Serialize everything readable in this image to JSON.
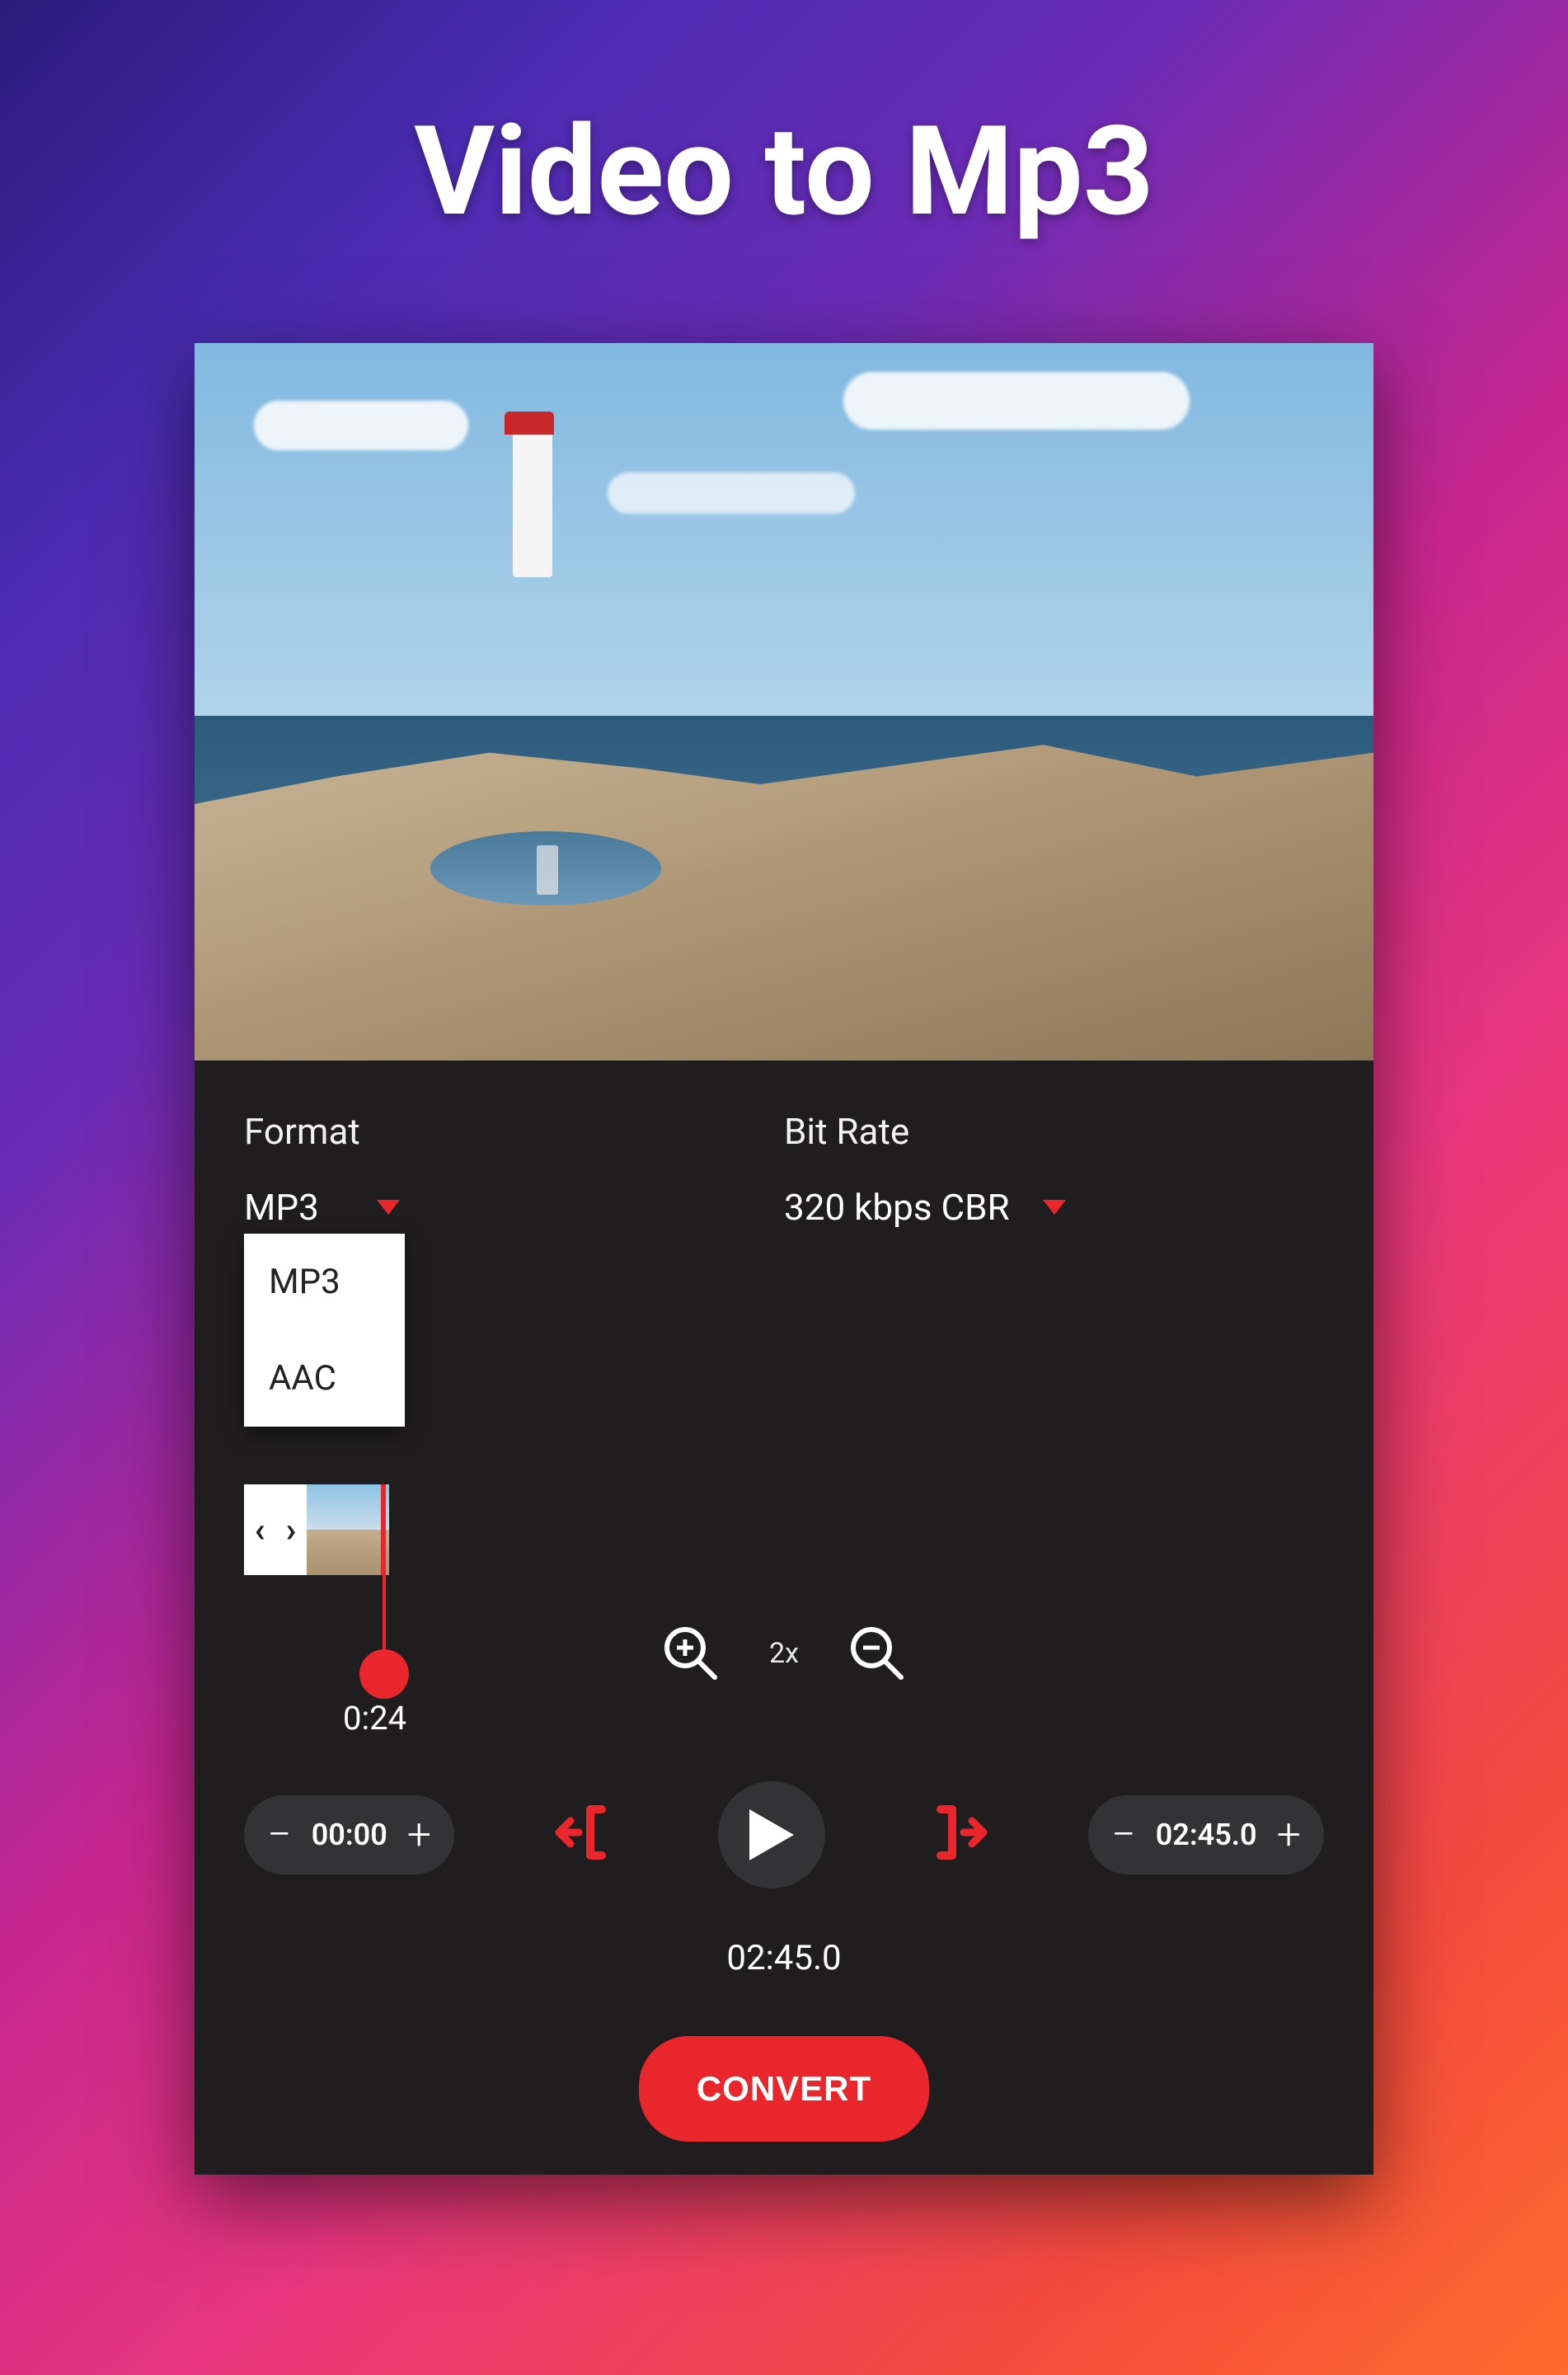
{
  "page": {
    "title": "Video to Mp3"
  },
  "format": {
    "label": "Format",
    "value": "MP3",
    "options": [
      "MP3",
      "AAC"
    ]
  },
  "bitrate": {
    "label": "Bit Rate",
    "value": "320 kbps CBR"
  },
  "timeline": {
    "playhead_time": "0:24",
    "zoom_level": "2x"
  },
  "trim": {
    "start": "00:00",
    "end": "02:45.0",
    "duration": "02:45.0"
  },
  "actions": {
    "convert": "CONVERT"
  },
  "colors": {
    "accent": "#e8262c",
    "panel": "#1f1d1e"
  }
}
